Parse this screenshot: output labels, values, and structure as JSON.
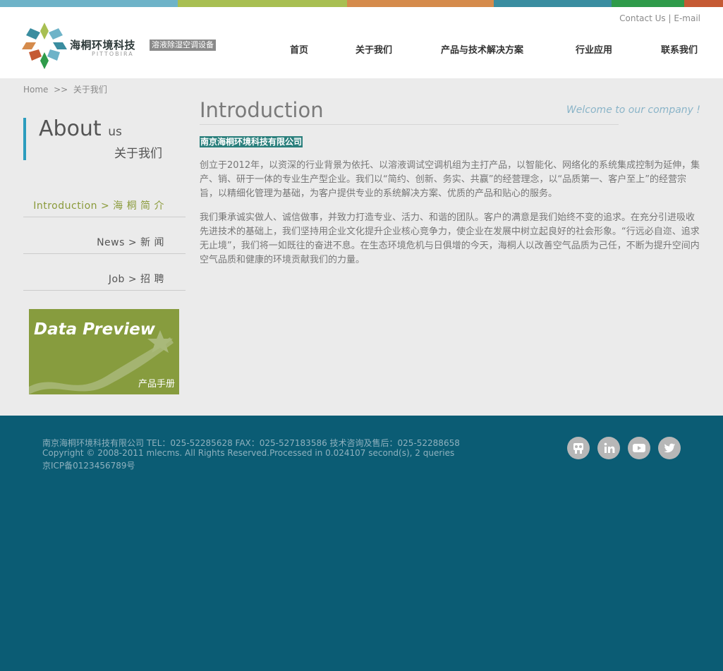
{
  "colors": {
    "bar": [
      "#6eb3c8",
      "#a8bf52",
      "#d58b4c",
      "#3a8da0",
      "#2f9b4a",
      "#c55a34"
    ],
    "accent": "#2c9dbe",
    "footer_bg": "#0b5c74",
    "content_bg": "#ebebeb",
    "company_highlight": "#2a7f7c",
    "banner_bg": "#879c3e"
  },
  "header": {
    "logo_cn": "海桐环境科技",
    "logo_en": "PITTOBIRA",
    "slogan": "溶液除湿空调设备",
    "contact_label": "Contact Us",
    "separator": "|",
    "email_label": "E-mail"
  },
  "nav": [
    {
      "label": "首页"
    },
    {
      "label": "关于我们"
    },
    {
      "label": "产品与技术解决方案"
    },
    {
      "label": "行业应用"
    },
    {
      "label": "联系我们"
    }
  ],
  "breadcrumb": {
    "home": "Home",
    "sep": ">>",
    "current": "关于我们"
  },
  "sidebar": {
    "title_en_big": "About",
    "title_en_small": "us",
    "title_cn": "关于我们",
    "items": [
      {
        "label": "Introduction > 海 桐 简 介",
        "active": true
      },
      {
        "label": "News > 新 闻",
        "active": false
      },
      {
        "label": "Job > 招 聘",
        "active": false
      }
    ],
    "banner": {
      "title": "Data Preview",
      "subtitle": "产品手册"
    }
  },
  "main": {
    "title": "Introduction",
    "welcome": "Welcome to our company !",
    "company_name": "南京海桐环境科技有限公司",
    "paragraphs": [
      "创立于2012年，以资深的行业背景为依托、以溶液调试空调机组为主打产品，以智能化、网络化的系统集成控制为延伸，集产、销、研于一体的专业生产型企业。我们以“简约、创新、务实、共赢”的经营理念，以“品质第一、客户至上”的经营宗旨，以精细化管理为基础，为客户提供专业的系统解决方案、优质的产品和贴心的服务。",
      "我们秉承诚实做人、诚信做事，并致力打造专业、活力、和谐的团队。客户的满意是我们始终不变的追求。在充分引进吸收先进技术的基础上，我们坚持用企业文化提升企业核心竞争力，使企业在发展中树立起良好的社会形象。“行远必自迩、追求无止境”，我们将一如既往的奋进不息。在生态环境危机与日俱增的今天，海桐人以改善空气品质为己任，不断为提升空间内空气品质和健康的环境贡献我们的力量。"
    ]
  },
  "footer": {
    "line1": "南京海桐环境科技有限公司  TEL：025-52285628  FAX：025-527183586  技术咨询及售后：025-52288658",
    "line2": "Copyright © 2008-2011 mlecms. All Rights Reserved.Processed in 0.024107 second(s), 2 queries",
    "line3": "京ICP备0123456789号",
    "social": [
      "slideshare-icon",
      "linkedin-icon",
      "youtube-icon",
      "twitter-icon"
    ]
  }
}
